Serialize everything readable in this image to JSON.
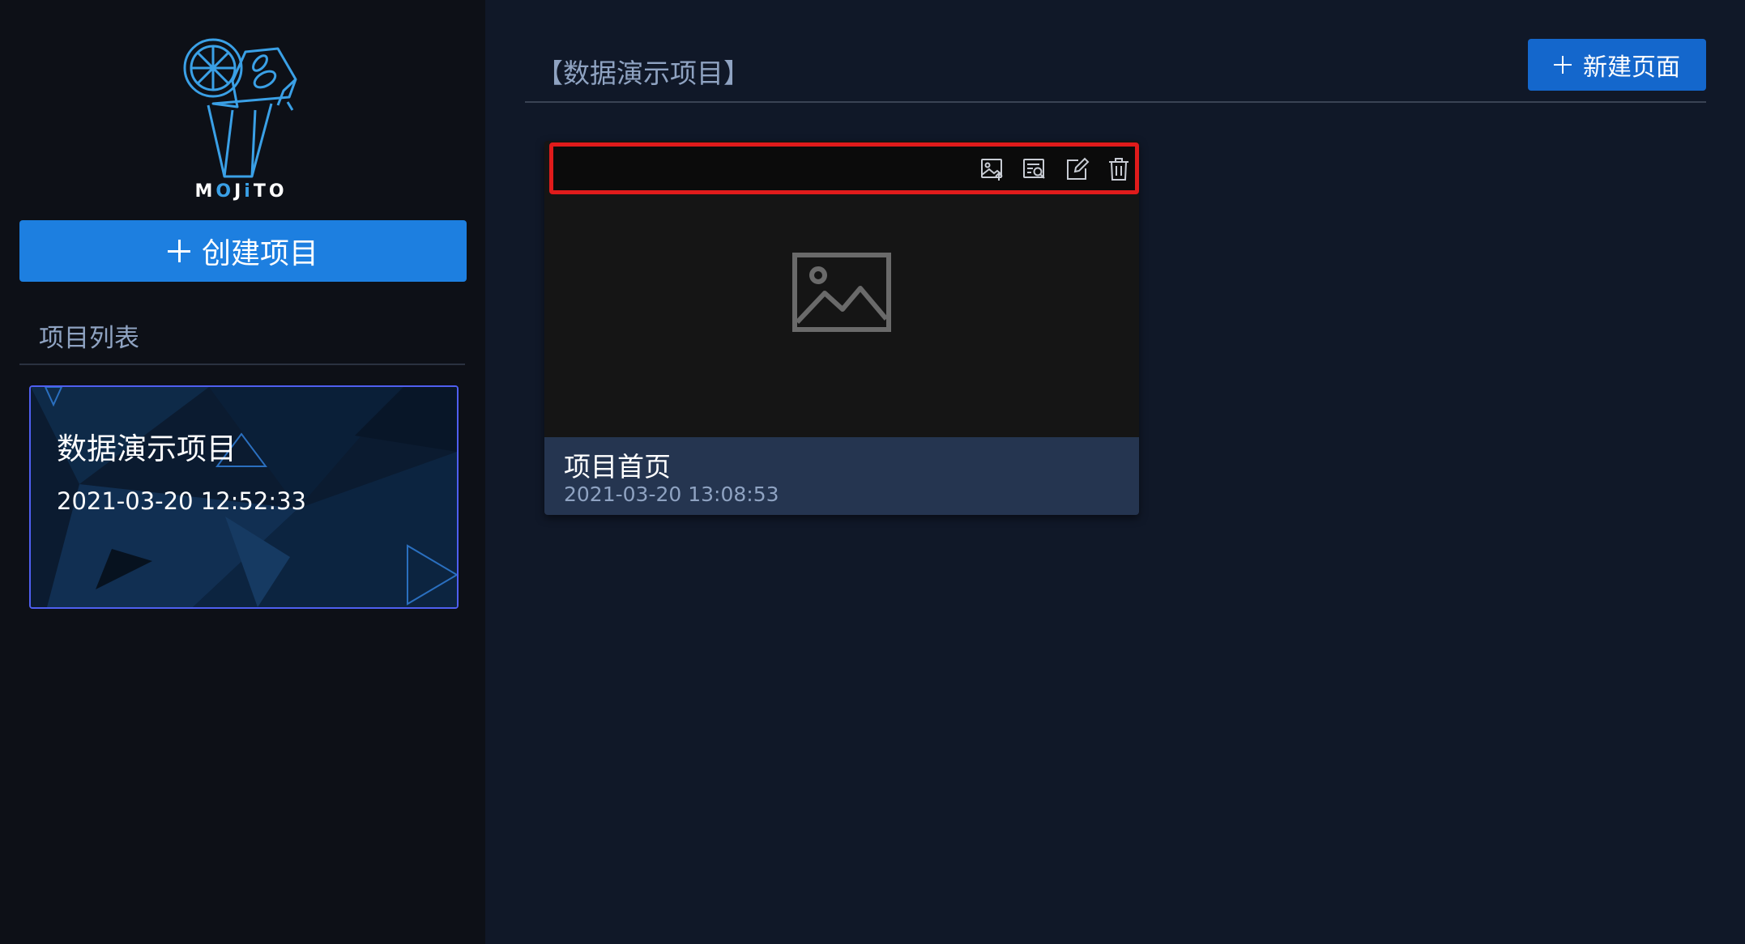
{
  "sidebar": {
    "logo_text_parts": [
      "M",
      "O",
      "J",
      "i",
      "TO"
    ],
    "create_button_label": "创建项目",
    "project_list_title": "项目列表",
    "projects": [
      {
        "name": "数据演示项目",
        "date": "2021-03-20 12:52:33"
      }
    ]
  },
  "main": {
    "title": "【数据演示项目】",
    "new_page_button_label": "新建页面",
    "pages": [
      {
        "name": "项目首页",
        "date": "2021-03-20 13:08:53",
        "toolbar_icons": [
          "image-upload-icon",
          "preview-icon",
          "edit-icon",
          "delete-icon"
        ]
      }
    ]
  },
  "colors": {
    "sidebar_bg": "#0d1017",
    "main_bg": "#101828",
    "primary_button": "#1d7fe0",
    "new_page_button": "#1467cc",
    "highlight_border": "#e01b1b",
    "project_card_border": "#4f5ff0",
    "card_footer": "#253550",
    "muted_text": "#8fa3c2"
  }
}
